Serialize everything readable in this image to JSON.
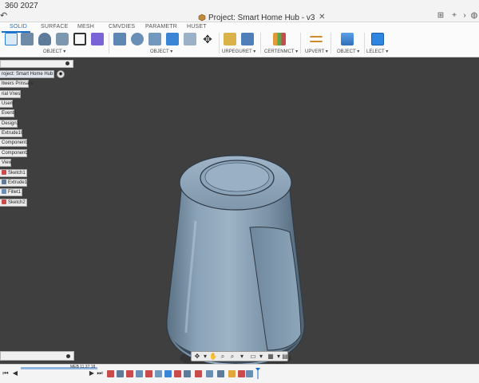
{
  "window": {
    "app_title": "360 2027",
    "document_title": "Project: Smart Home Hub - v3"
  },
  "ribbon": {
    "tabs": [
      {
        "label": "SOLID",
        "active": true
      },
      {
        "label": "SURFACE",
        "active": false
      },
      {
        "label": "MESH",
        "active": false
      },
      {
        "label": "CMVDIES",
        "active": false
      },
      {
        "label": "PARAMETR",
        "active": false
      },
      {
        "label": "HUSET",
        "active": false
      }
    ],
    "groups": [
      {
        "label": "OBJECT ▾"
      },
      {
        "label": "OBJECT ▾"
      },
      {
        "label": "URPEGURET ▾"
      },
      {
        "label": "CERTENMCT ▾"
      },
      {
        "label": "UPVERT ▾"
      },
      {
        "label": "OBJECT ▾"
      },
      {
        "label": "LELECT ▾"
      }
    ]
  },
  "browser": {
    "root": "roject: Smart Home Hub - v3",
    "items": [
      {
        "label": "ltwers Prinsars"
      },
      {
        "label": "rial Vnes"
      },
      {
        "label": "Usem"
      },
      {
        "label": "Events"
      },
      {
        "label": "Design1"
      },
      {
        "label": "Extrude10"
      },
      {
        "label": "Component1"
      },
      {
        "label": "Component2"
      },
      {
        "label": "View"
      },
      {
        "label": "Sketch1"
      },
      {
        "label": "Extrude1"
      },
      {
        "label": "Fillet1"
      },
      {
        "label": "Sketch2"
      }
    ]
  },
  "timeline": {
    "time_label": "MEB 11.37.18"
  },
  "colors": {
    "accent": "#1a6fc9",
    "viewport": "#3f3f3f",
    "model_body": "#7d96ad"
  }
}
